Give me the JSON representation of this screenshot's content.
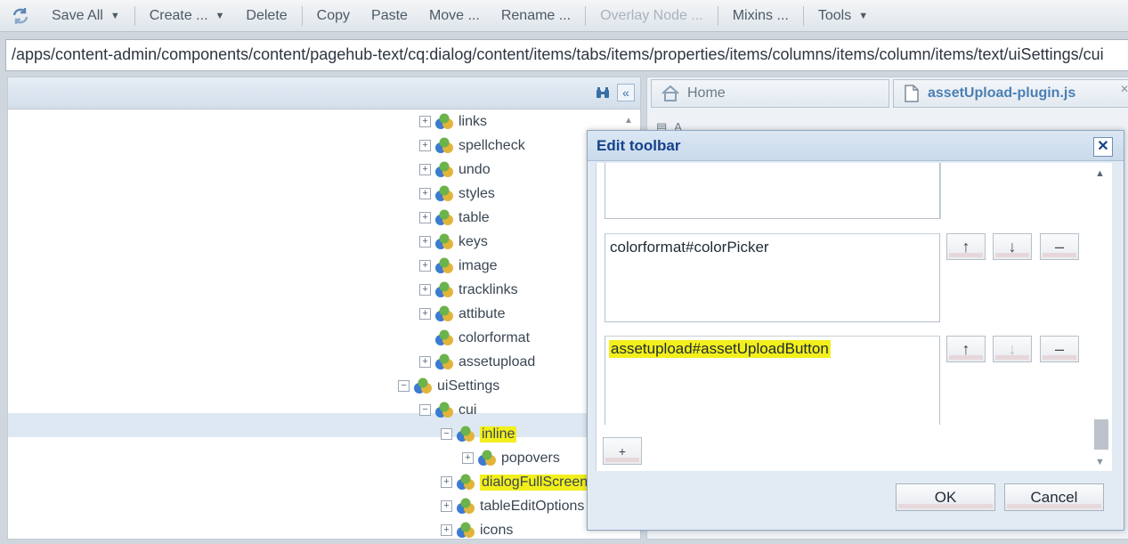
{
  "toolbar": {
    "save_all": "Save All",
    "create": "Create ...",
    "delete": "Delete",
    "copy": "Copy",
    "paste": "Paste",
    "move": "Move ...",
    "rename": "Rename ...",
    "overlay_node": "Overlay Node ...",
    "mixins": "Mixins ...",
    "tools": "Tools"
  },
  "path": "/apps/content-admin/components/content/pagehub-text/cq:dialog/content/items/tabs/items/properties/items/columns/items/column/items/text/uiSettings/cui",
  "tree": {
    "items": [
      {
        "label": "links"
      },
      {
        "label": "spellcheck"
      },
      {
        "label": "undo"
      },
      {
        "label": "styles"
      },
      {
        "label": "table"
      },
      {
        "label": "keys"
      },
      {
        "label": "image"
      },
      {
        "label": "tracklinks"
      },
      {
        "label": "attibute"
      },
      {
        "label": "colorformat"
      },
      {
        "label": "assetupload"
      },
      {
        "label": "uiSettings"
      },
      {
        "label": "cui"
      },
      {
        "label": "inline"
      },
      {
        "label": "popovers"
      },
      {
        "label": "dialogFullScreen"
      },
      {
        "label": "tableEditOptions"
      },
      {
        "label": "icons"
      }
    ]
  },
  "tabs": {
    "home": "Home",
    "file": "assetUpload-plugin.js"
  },
  "dialog": {
    "title": "Edit toolbar",
    "entries": [
      {
        "value": ""
      },
      {
        "value": "colorformat#colorPicker"
      },
      {
        "value": "assetupload#assetUploadButton"
      }
    ],
    "up": "↑",
    "down": "↓",
    "remove": "–",
    "add": "+",
    "ok": "OK",
    "cancel": "Cancel"
  },
  "colors": {
    "highlight": "#f2ef1c",
    "dialog_title": "#15428b",
    "selected_row": "#dde8f2"
  }
}
